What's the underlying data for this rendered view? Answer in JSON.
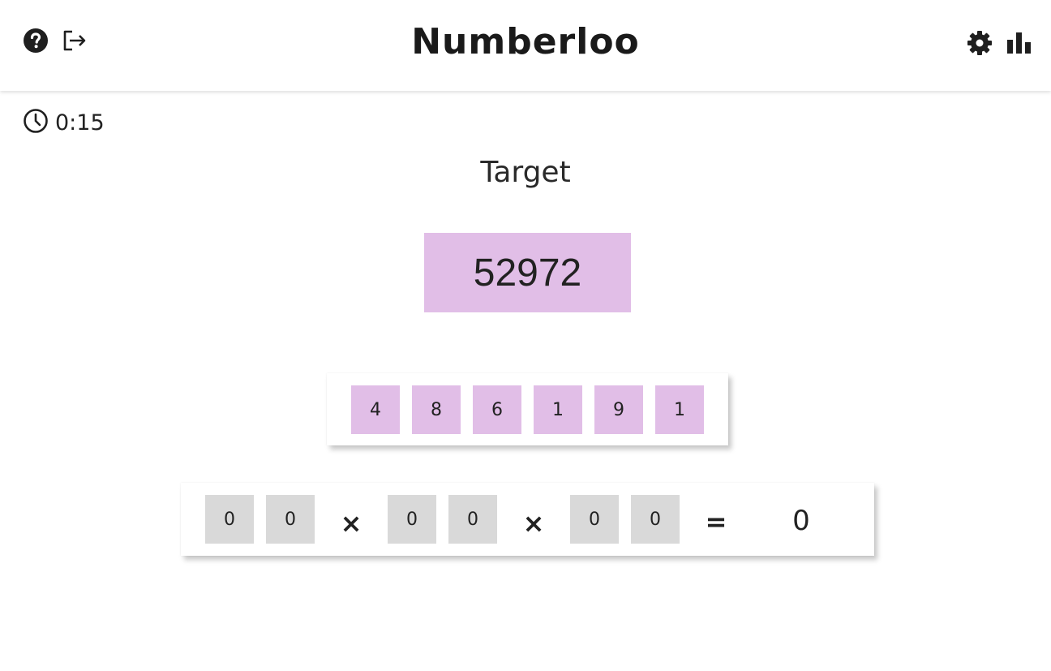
{
  "header": {
    "title": "Numberloo",
    "icons": [
      "help-icon",
      "logout-icon",
      "gear-icon",
      "stats-icon"
    ]
  },
  "timer": {
    "value": "0:15"
  },
  "target": {
    "label": "Target",
    "value": "52972"
  },
  "numbers": [
    "4",
    "8",
    "6",
    "1",
    "9",
    "1"
  ],
  "equation": {
    "slots": [
      "0",
      "0",
      "0",
      "0",
      "0",
      "0"
    ],
    "operators": [
      "×",
      "×"
    ],
    "equals": "=",
    "result": "0"
  },
  "colors": {
    "tile_accent": "#e1bee7",
    "tile_empty": "#d9d9d9",
    "text": "#212121"
  }
}
